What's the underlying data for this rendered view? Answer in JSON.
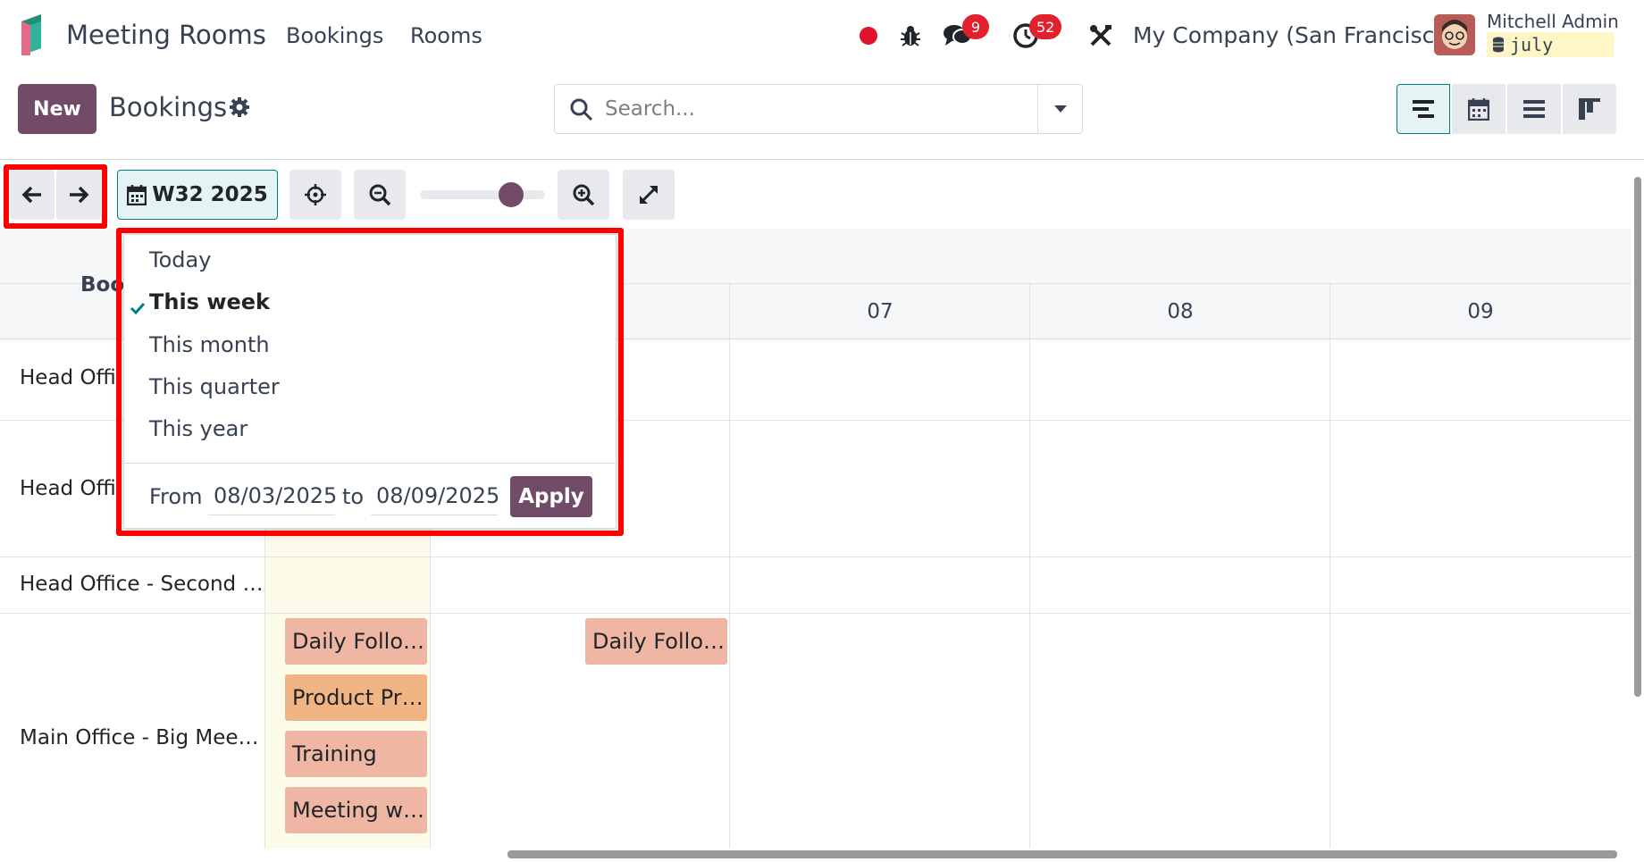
{
  "app": {
    "name": "Meeting Rooms",
    "menu": [
      "Bookings",
      "Rooms"
    ]
  },
  "systray": {
    "messages_count": "9",
    "activities_count": "52",
    "company": "My Company (San Francisco)",
    "user_name": "Mitchell Admin",
    "database": "july"
  },
  "control_panel": {
    "new_label": "New",
    "title": "Bookings",
    "search_placeholder": "Search..."
  },
  "toolbar": {
    "period_label": "W32 2025",
    "zoom_level": 0.66
  },
  "gantt": {
    "rows_header": "Boo",
    "days": [
      "07",
      "08",
      "09"
    ],
    "rows": [
      "Head Offi",
      "Head Offi",
      "Head Office - Second …",
      "Main Office - Big Mee…"
    ],
    "pills": [
      {
        "label": "Daily Follo…",
        "color": "#efb7a3"
      },
      {
        "label": "Product Pr…",
        "color": "#f1b583"
      },
      {
        "label": "Training",
        "color": "#efb7a3"
      },
      {
        "label": "Meeting w…",
        "color": "#efb7a3"
      },
      {
        "label": "Daily Follo…",
        "color": "#efb7a3"
      }
    ]
  },
  "date_dropdown": {
    "options": [
      "Today",
      "This week",
      "This month",
      "This quarter",
      "This year"
    ],
    "selected": "This week",
    "from_label": "From",
    "from_value": "08/03/2025",
    "to_label": "to",
    "to_value": "08/09/2025",
    "apply_label": "Apply"
  },
  "colors": {
    "brand": "#714b67",
    "accent": "#017e84",
    "highlight_box": "#ff0000"
  }
}
